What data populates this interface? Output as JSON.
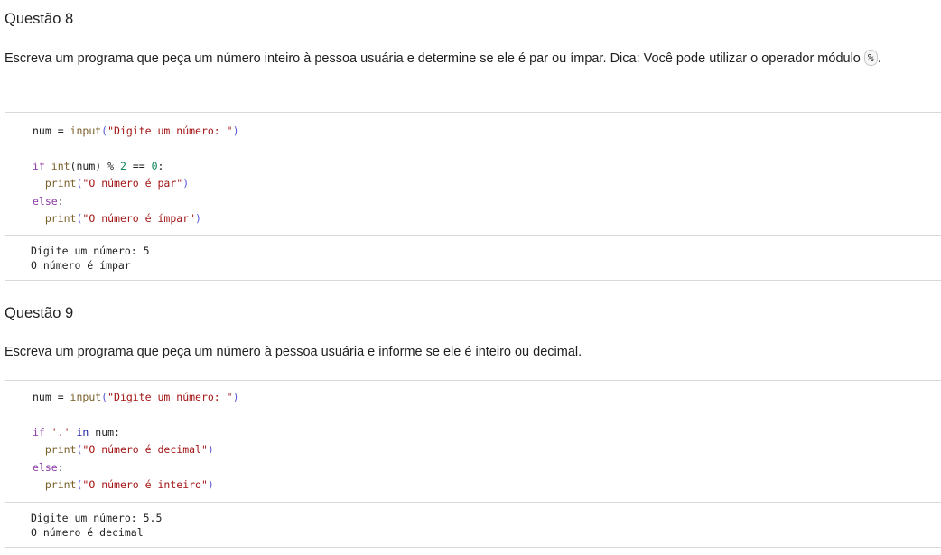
{
  "q8": {
    "title": "Questão 8",
    "text_before": "Escreva um programa que peça um número inteiro à pessoa usuária e determine se ele é par ou ímpar. Dica: Você pode utilizar o operador módulo ",
    "inline_code": "%",
    "text_after": ".",
    "code": {
      "line1": {
        "a": "num = ",
        "b": "input",
        "c": "(",
        "d": "\"Digite um número: \"",
        "e": ")"
      },
      "line3": {
        "a": "if ",
        "b": "int",
        "c": "(num) % ",
        "d": "2",
        "e": " == ",
        "f": "0",
        "g": ":"
      },
      "line4": {
        "a": "  ",
        "b": "print",
        "c": "(",
        "d": "\"O número é par\"",
        "e": ")"
      },
      "line5": {
        "a": "else",
        "b": ":"
      },
      "line6": {
        "a": "  ",
        "b": "print",
        "c": "(",
        "d": "\"O número é ímpar\"",
        "e": ")"
      }
    },
    "output": [
      "Digite um número: 5",
      "O número é ímpar"
    ]
  },
  "q9": {
    "title": "Questão 9",
    "text": "Escreva um programa que peça um número à pessoa usuária e informe se ele é inteiro ou decimal.",
    "code": {
      "line1": {
        "a": "num = ",
        "b": "input",
        "c": "(",
        "d": "\"Digite um número: \"",
        "e": ")"
      },
      "line3": {
        "a": "if ",
        "b": "'.'",
        "c": " in ",
        "d": "num:"
      },
      "line4": {
        "a": "  ",
        "b": "print",
        "c": "(",
        "d": "\"O número é decimal\"",
        "e": ")"
      },
      "line5": {
        "a": "else",
        "b": ":"
      },
      "line6": {
        "a": "  ",
        "b": "print",
        "c": "(",
        "d": "\"O número é inteiro\"",
        "e": ")"
      }
    },
    "output": [
      "Digite um número: 5.5",
      "O número é decimal"
    ]
  }
}
